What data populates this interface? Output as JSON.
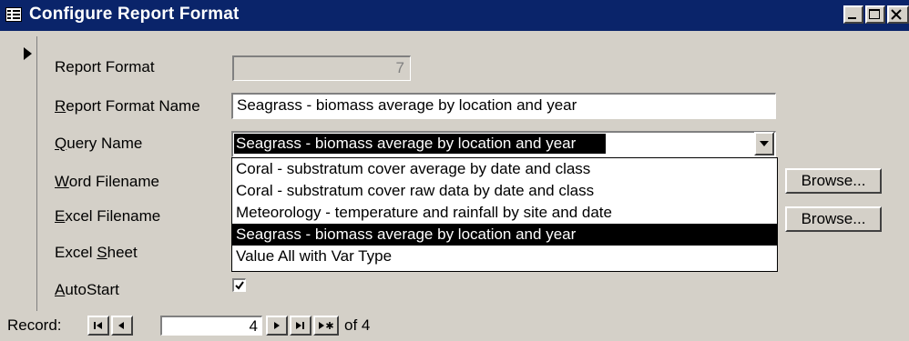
{
  "window": {
    "title": "Configure Report Format"
  },
  "form": {
    "report_format": {
      "label": "Report Format",
      "value": "7"
    },
    "report_format_name": {
      "label_u": "R",
      "label_rest": "eport Format Name",
      "value": "Seagrass - biomass average by location and year"
    },
    "query_name": {
      "label_u": "Q",
      "label_rest": "uery Name",
      "value": "Seagrass - biomass average by location and year"
    },
    "word_filename": {
      "label_u": "W",
      "label_rest": "ord Filename"
    },
    "excel_filename": {
      "label_u": "E",
      "label_rest": "xcel Filename"
    },
    "excel_sheet": {
      "label_pre": "Excel ",
      "label_u": "S",
      "label_rest": "heet"
    },
    "autostart": {
      "label_u": "A",
      "label_rest": "utoStart",
      "checked": true
    },
    "browse_label": "Browse..."
  },
  "dropdown": {
    "items": [
      "Coral - substratum cover average by date and class",
      "Coral - substratum cover raw data by date and class",
      "Meteorology - temperature and rainfall by site and date",
      "Seagrass - biomass average by location and year",
      "Value All with Var Type"
    ],
    "selected_index": 3
  },
  "navigation": {
    "label": "Record:",
    "current": "4",
    "of_text": "of  4"
  }
}
